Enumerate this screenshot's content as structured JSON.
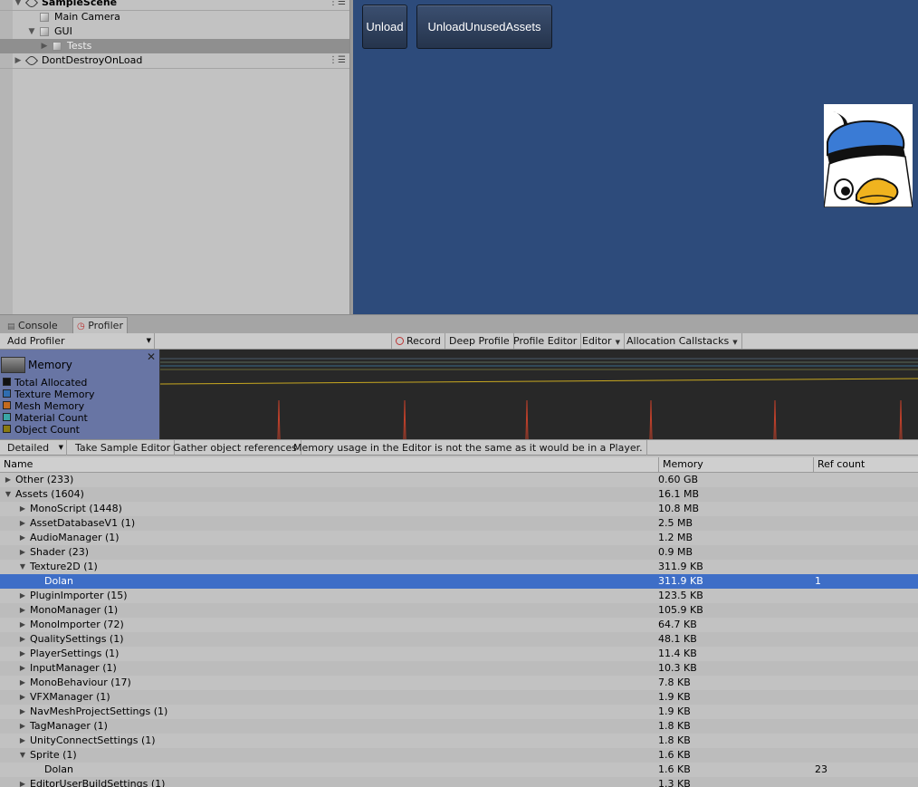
{
  "hierarchy": {
    "items": [
      {
        "label": "SampleScene",
        "kind": "scene",
        "expanded": true
      },
      {
        "label": "Main Camera",
        "kind": "object"
      },
      {
        "label": "GUI",
        "kind": "object",
        "expanded": true
      },
      {
        "label": "Tests",
        "kind": "object",
        "selected": true
      },
      {
        "label": "DontDestroyOnLoad",
        "kind": "scene",
        "expanded": false
      }
    ]
  },
  "game": {
    "unload_label": "Unload",
    "unload_unused_label": "UnloadUnusedAssets"
  },
  "tabs": [
    {
      "label": "Console",
      "active": false
    },
    {
      "label": "Profiler",
      "active": true
    }
  ],
  "profiler_toolbar": {
    "add_profiler": "Add Profiler",
    "record": "Record",
    "deep_profile": "Deep Profile",
    "profile_editor": "Profile Editor",
    "editor_dropdown": "Editor",
    "allocation_callstacks": "Allocation Callstacks"
  },
  "memory_panel": {
    "title": "Memory",
    "legend": [
      {
        "label": "Total Allocated",
        "color": "#111111"
      },
      {
        "label": "Texture Memory",
        "color": "#2f6db0"
      },
      {
        "label": "Mesh Memory",
        "color": "#c46a1e"
      },
      {
        "label": "Material Count",
        "color": "#3aa6a6"
      },
      {
        "label": "Object Count",
        "color": "#8a7a10"
      }
    ]
  },
  "detail_toolbar": {
    "mode": "Detailed",
    "take_sample": "Take Sample Editor",
    "gather_refs": "Gather object references",
    "notice": "Memory usage in the Editor is not the same as it would be in a Player."
  },
  "table": {
    "columns": {
      "name": "Name",
      "memory": "Memory",
      "refcount": "Ref count"
    },
    "rows": [
      {
        "name": "Other (233)",
        "memory": "0.60 GB",
        "ref": "",
        "depth": 0,
        "arrow": "right"
      },
      {
        "name": "Assets (1604)",
        "memory": "16.1 MB",
        "ref": "",
        "depth": 0,
        "arrow": "down"
      },
      {
        "name": "MonoScript (1448)",
        "memory": "10.8 MB",
        "ref": "",
        "depth": 1,
        "arrow": "right"
      },
      {
        "name": "AssetDatabaseV1 (1)",
        "memory": "2.5 MB",
        "ref": "",
        "depth": 1,
        "arrow": "right"
      },
      {
        "name": "AudioManager (1)",
        "memory": "1.2 MB",
        "ref": "",
        "depth": 1,
        "arrow": "right"
      },
      {
        "name": "Shader (23)",
        "memory": "0.9 MB",
        "ref": "",
        "depth": 1,
        "arrow": "right"
      },
      {
        "name": "Texture2D (1)",
        "memory": "311.9 KB",
        "ref": "",
        "depth": 1,
        "arrow": "down"
      },
      {
        "name": "Dolan",
        "memory": "311.9 KB",
        "ref": "1",
        "depth": 2,
        "arrow": "",
        "selected": true
      },
      {
        "name": "PluginImporter (15)",
        "memory": "123.5 KB",
        "ref": "",
        "depth": 1,
        "arrow": "right"
      },
      {
        "name": "MonoManager (1)",
        "memory": "105.9 KB",
        "ref": "",
        "depth": 1,
        "arrow": "right"
      },
      {
        "name": "MonoImporter (72)",
        "memory": "64.7 KB",
        "ref": "",
        "depth": 1,
        "arrow": "right"
      },
      {
        "name": "QualitySettings (1)",
        "memory": "48.1 KB",
        "ref": "",
        "depth": 1,
        "arrow": "right"
      },
      {
        "name": "PlayerSettings (1)",
        "memory": "11.4 KB",
        "ref": "",
        "depth": 1,
        "arrow": "right"
      },
      {
        "name": "InputManager (1)",
        "memory": "10.3 KB",
        "ref": "",
        "depth": 1,
        "arrow": "right"
      },
      {
        "name": "MonoBehaviour (17)",
        "memory": "7.8 KB",
        "ref": "",
        "depth": 1,
        "arrow": "right"
      },
      {
        "name": "VFXManager (1)",
        "memory": "1.9 KB",
        "ref": "",
        "depth": 1,
        "arrow": "right"
      },
      {
        "name": "NavMeshProjectSettings (1)",
        "memory": "1.9 KB",
        "ref": "",
        "depth": 1,
        "arrow": "right"
      },
      {
        "name": "TagManager (1)",
        "memory": "1.8 KB",
        "ref": "",
        "depth": 1,
        "arrow": "right"
      },
      {
        "name": "UnityConnectSettings (1)",
        "memory": "1.8 KB",
        "ref": "",
        "depth": 1,
        "arrow": "right"
      },
      {
        "name": "Sprite (1)",
        "memory": "1.6 KB",
        "ref": "",
        "depth": 1,
        "arrow": "down"
      },
      {
        "name": "Dolan",
        "memory": "1.6 KB",
        "ref": "23",
        "depth": 2,
        "arrow": ""
      },
      {
        "name": "EditorUserBuildSettings (1)",
        "memory": "1.3 KB",
        "ref": "",
        "depth": 1,
        "arrow": "right"
      }
    ]
  }
}
